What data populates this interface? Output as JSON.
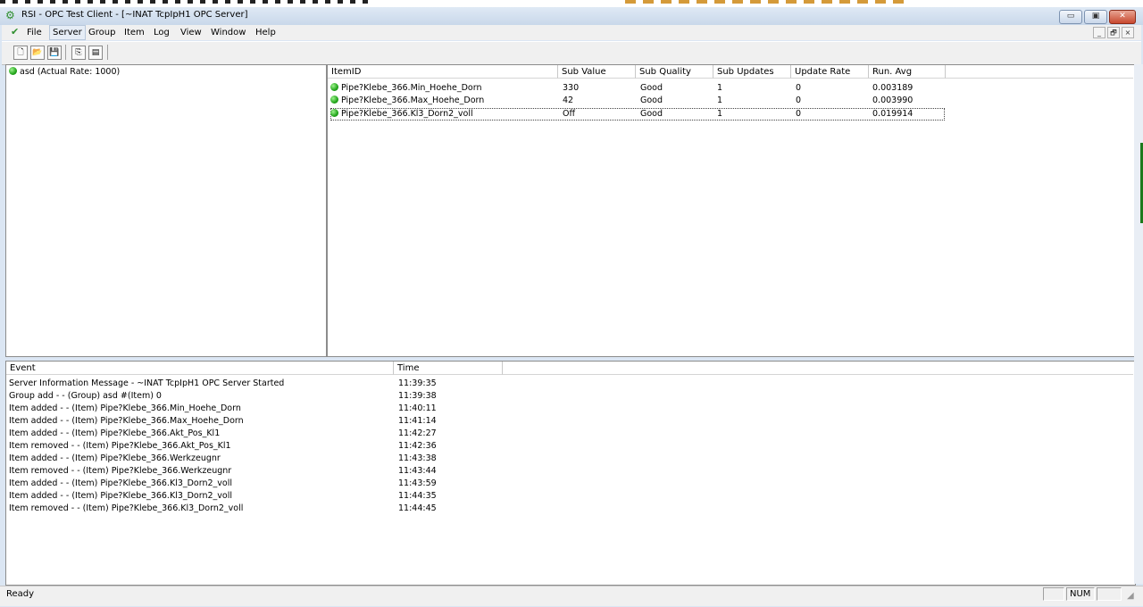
{
  "window": {
    "title": "RSI - OPC Test Client - [~INAT TcpIpH1 OPC Server]",
    "app_icon": "opc-app-icon",
    "caption_buttons": {
      "minimize": "▭",
      "maximize": "▣",
      "close": "✕"
    }
  },
  "menu": {
    "items": [
      "File",
      "Server",
      "Group",
      "Item",
      "Log",
      "View",
      "Window",
      "Help"
    ],
    "active": "Server",
    "mdi_buttons": {
      "minimize": "_",
      "restore": "🗗",
      "close": "×"
    }
  },
  "toolbar": {
    "buttons": [
      {
        "name": "new-icon",
        "glyph": "🗋"
      },
      {
        "name": "open-icon",
        "glyph": "📂"
      },
      {
        "name": "save-icon",
        "glyph": "💾"
      },
      {
        "name": "copy-icon",
        "glyph": "⎘"
      },
      {
        "name": "properties-icon",
        "glyph": "▤"
      }
    ]
  },
  "groups": {
    "items": [
      {
        "label": "asd (Actual Rate: 1000)",
        "status": "green"
      }
    ]
  },
  "items_table": {
    "headers": [
      "ItemID",
      "Sub Value",
      "Sub Quality",
      "Sub Updates",
      "Update Rate",
      "Run. Avg"
    ],
    "rows": [
      {
        "id": "Pipe?Klebe_366.Min_Hoehe_Dorn",
        "value": "330",
        "quality": "Good",
        "updates": "1",
        "rate": "0",
        "avg": "0.003189"
      },
      {
        "id": "Pipe?Klebe_366.Max_Hoehe_Dorn",
        "value": "42",
        "quality": "Good",
        "updates": "1",
        "rate": "0",
        "avg": "0.003990"
      },
      {
        "id": "Pipe?Klebe_366.Kl3_Dorn2_voll",
        "value": "Off",
        "quality": "Good",
        "updates": "1",
        "rate": "0",
        "avg": "0.019914"
      }
    ]
  },
  "log": {
    "headers": [
      "Event",
      "Time"
    ],
    "rows": [
      {
        "event": "Server Information Message - ~INAT TcpIpH1 OPC Server      Started",
        "time": "11:39:35"
      },
      {
        "event": "Group add -  - (Group) asd #(Item) 0",
        "time": "11:39:38"
      },
      {
        "event": "Item added -  - (Item) Pipe?Klebe_366.Min_Hoehe_Dorn",
        "time": "11:40:11"
      },
      {
        "event": "Item added -  - (Item) Pipe?Klebe_366.Max_Hoehe_Dorn",
        "time": "11:41:14"
      },
      {
        "event": "Item added -  - (Item) Pipe?Klebe_366.Akt_Pos_Kl1",
        "time": "11:42:27"
      },
      {
        "event": "Item removed -  - (Item) Pipe?Klebe_366.Akt_Pos_Kl1",
        "time": "11:42:36"
      },
      {
        "event": "Item added -  - (Item) Pipe?Klebe_366.Werkzeugnr",
        "time": "11:43:38"
      },
      {
        "event": "Item removed -  - (Item) Pipe?Klebe_366.Werkzeugnr",
        "time": "11:43:44"
      },
      {
        "event": "Item added -  - (Item) Pipe?Klebe_366.Kl3_Dorn2_voll",
        "time": "11:43:59"
      },
      {
        "event": "Item added -  - (Item) Pipe?Klebe_366.Kl3_Dorn2_voll",
        "time": "11:44:35"
      },
      {
        "event": "Item removed -  - (Item) Pipe?Klebe_366.Kl3_Dorn2_voll",
        "time": "11:44:45"
      }
    ]
  },
  "status": {
    "text": "Ready",
    "indicators": [
      "",
      "NUM",
      ""
    ]
  }
}
